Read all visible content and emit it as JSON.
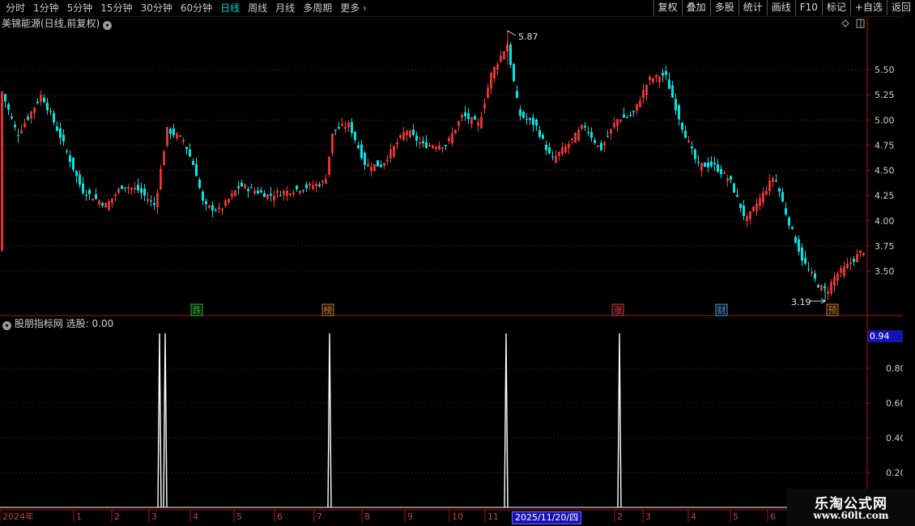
{
  "toolbar": {
    "periods": [
      "分时",
      "1分钟",
      "5分钟",
      "15分钟",
      "30分钟",
      "60分钟",
      "日线",
      "周线",
      "月线",
      "多周期",
      "更多"
    ],
    "active_period": "日线",
    "more_arrow": "›",
    "buttons": [
      "复权",
      "叠加",
      "多股",
      "统计",
      "画线",
      "F10",
      "标记",
      "+自选",
      "返回"
    ]
  },
  "main_chart": {
    "title": "美锦能源(日线,前复权)",
    "title_icon": "chevron-down-icon",
    "y_ticks": [
      "5.50",
      "5.25",
      "5.00",
      "4.75",
      "4.50",
      "4.25",
      "4.00",
      "3.75",
      "3.50"
    ],
    "high_label": "5.87",
    "low_label": "3.19",
    "markers": [
      {
        "text": "跌",
        "color": "#22c022"
      },
      {
        "text": "榜",
        "color": "#d07a1a"
      },
      {
        "text": "涨",
        "color": "#e03030"
      },
      {
        "text": "财",
        "color": "#3a9ae0"
      },
      {
        "text": "预",
        "color": "#d07a1a"
      }
    ],
    "colors": {
      "up": "#ff3b3b",
      "down": "#00e6e6",
      "grid": "#7a1515",
      "axis": "#b01010"
    }
  },
  "indicator": {
    "title": "股朋指标网",
    "value_label": "选股: 0.00",
    "current_value": "0.94",
    "y_ticks": [
      "0.80",
      "0.60",
      "0.40",
      "0.20"
    ],
    "peak_value": 1.0
  },
  "x_axis": {
    "labels": [
      "2024年",
      "1",
      "2",
      "3",
      "4",
      "5",
      "6",
      "7",
      "8",
      "9",
      "10",
      "11",
      "2",
      "3",
      "4",
      "5",
      "6"
    ],
    "cursor_date": "2025/11/20/四"
  },
  "watermark": {
    "line1": "乐淘公式网",
    "line2": "www.60lt.com"
  }
}
